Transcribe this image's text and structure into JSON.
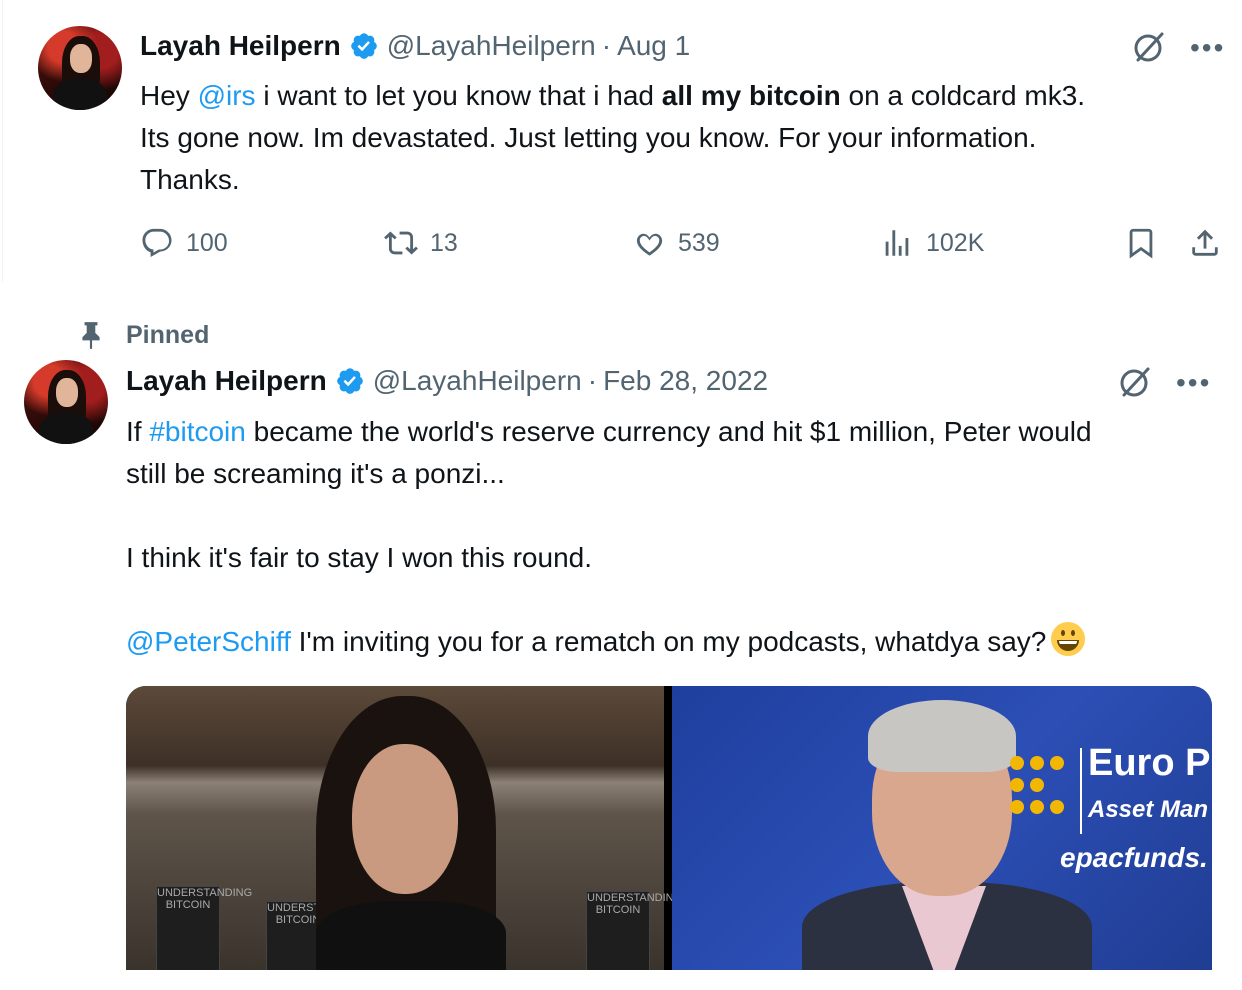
{
  "tweets": [
    {
      "author_name": "Layah Heilpern",
      "handle": "@LayahHeilpern",
      "separator": "·",
      "date": "Aug 1",
      "text": {
        "p1": "Hey ",
        "mention": "@irs",
        "p2": " i want to let you know that i had ",
        "bold": "all my bitcoin",
        "p3": " on a coldcard mk3.",
        "line2": "Its gone now. Im devastated. Just letting you know. For your information.",
        "line3": "Thanks."
      },
      "stats": {
        "replies": "100",
        "reposts": "13",
        "likes": "539",
        "views": "102K"
      }
    },
    {
      "pinned_label": "Pinned",
      "author_name": "Layah Heilpern",
      "handle": "@LayahHeilpern",
      "separator": "·",
      "date": "Feb 28, 2022",
      "text": {
        "p1": "If ",
        "hashtag": "#bitcoin",
        "p2": " became the world's reserve currency and hit $1 million, Peter would",
        "line2": "still be screaming it's a ponzi...",
        "line3": "I think it's fair to stay I won this round.",
        "mention": "@PeterSchiff",
        "p4": " I'm inviting you for a rematch on my podcasts, whatdya say?"
      },
      "media": {
        "logo_line1": "Euro P",
        "logo_line2": "Asset Man",
        "logo_line3": "epacfunds.",
        "book_label": "UNDERSTANDING BITCOIN"
      }
    }
  ],
  "colors": {
    "accent": "#1d9bf0",
    "muted": "#536471",
    "text": "#0f1419",
    "logo": "#f2b705"
  },
  "icons": [
    "verified-badge-icon",
    "grok-icon",
    "more-icon",
    "reply-icon",
    "repost-icon",
    "like-icon",
    "views-icon",
    "bookmark-icon",
    "share-icon",
    "pin-icon",
    "grinning-emoji-icon"
  ]
}
